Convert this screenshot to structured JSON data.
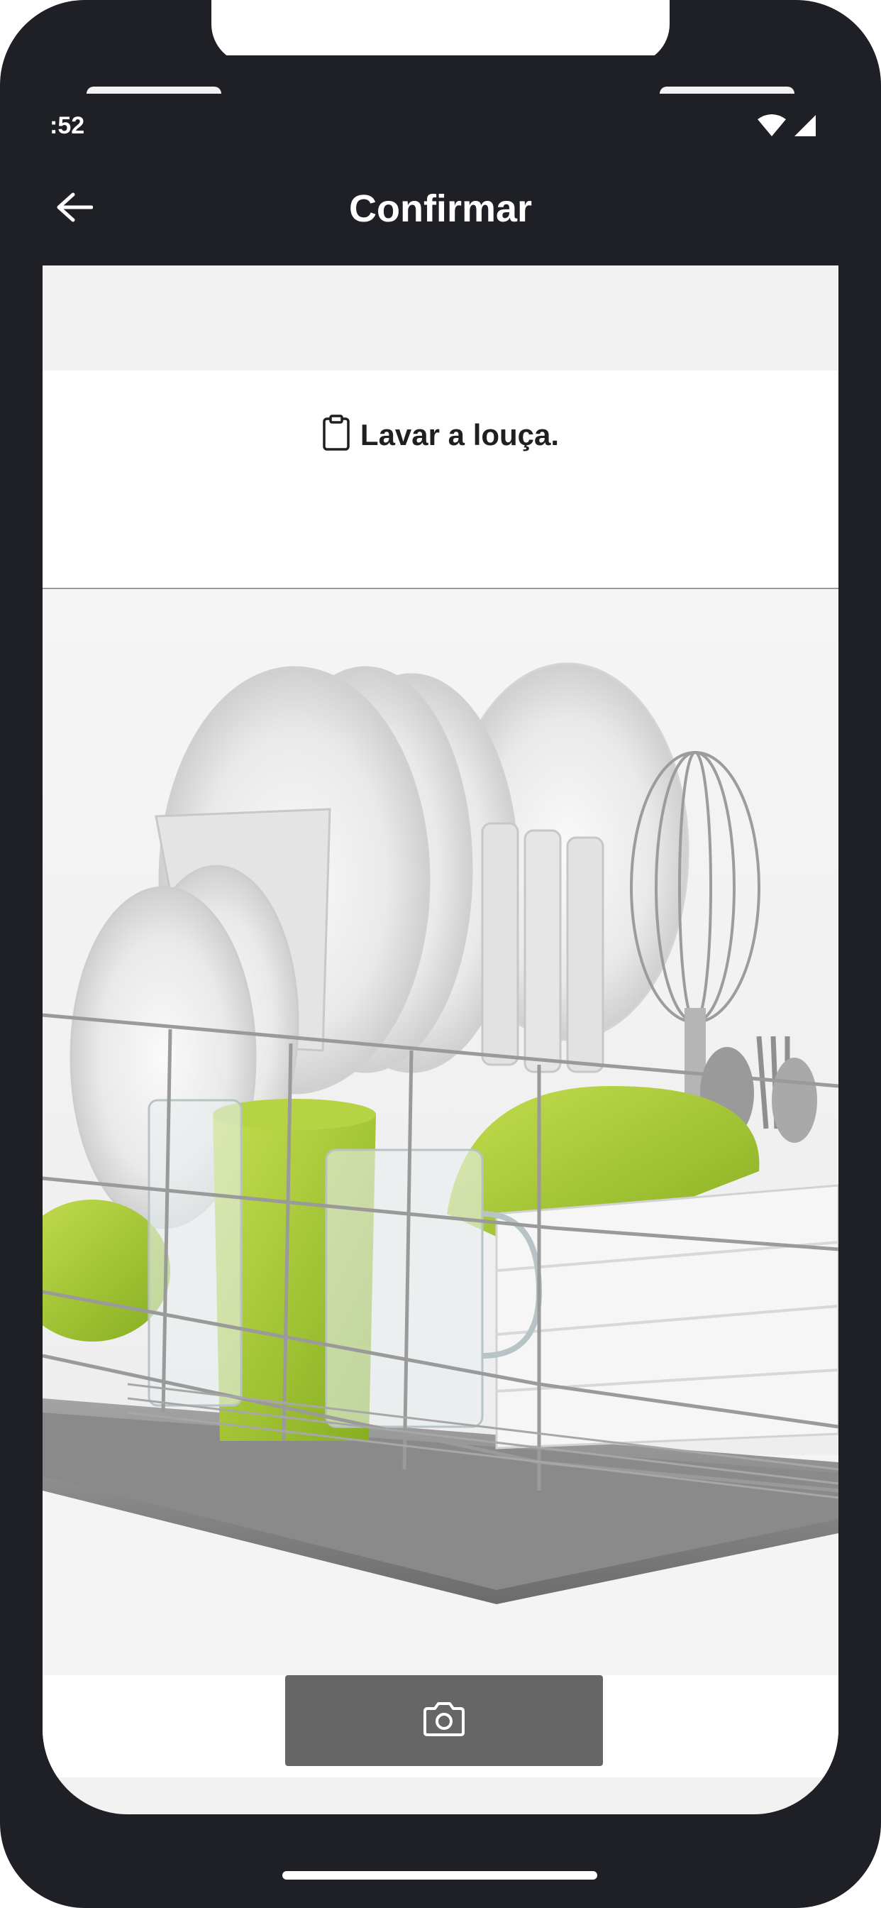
{
  "status_bar": {
    "time": ":52",
    "icons": [
      "wifi-icon",
      "cellular-signal-icon"
    ]
  },
  "header": {
    "title": "Confirmar",
    "back_icon": "arrow-left-icon"
  },
  "task": {
    "icon": "clipboard-icon",
    "text": "Lavar a louça."
  },
  "photo": {
    "subject": "dish-rack-photo"
  },
  "actions": {
    "camera_icon": "camera-icon"
  },
  "colors": {
    "frame": "#1e2025",
    "header_bg": "#1e2025",
    "content_bg": "#f2f2f2",
    "button_bg": "#666666",
    "accent_green": "#9cc23c"
  }
}
